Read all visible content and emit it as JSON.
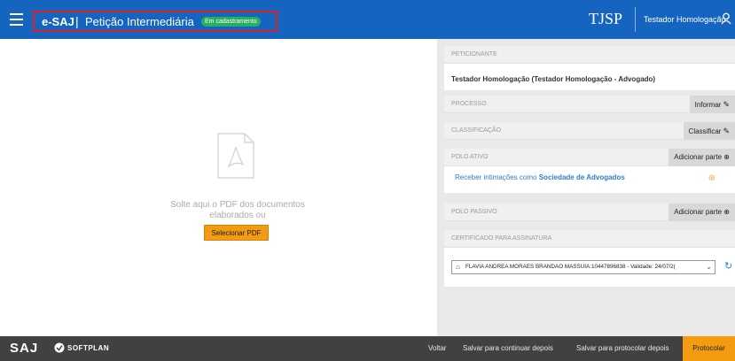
{
  "header": {
    "brand": "e-SAJ",
    "separator": "|",
    "title": "Petição Intermediária",
    "status_badge": "Em cadastramento",
    "court_logo": "TJSP",
    "user_name": "Testador Homologação",
    "menu_icon": "hamburger-icon",
    "user_icon": "user-icon"
  },
  "dropzone": {
    "icon": "pdf-file-icon",
    "text": "Solte aqui o PDF dos documentos elaborados ou",
    "button": "Selecionar PDF"
  },
  "panel": {
    "peticionante": {
      "label": "PETICIONANTE",
      "value": "Testador Homologação (Testador Homologação - Advogado)"
    },
    "processo": {
      "label": "PROCESSO",
      "action": "Informar"
    },
    "classificacao": {
      "label": "CLASSIFICAÇÃO",
      "action": "Classificar"
    },
    "polo_ativo": {
      "label": "POLO ATIVO",
      "action": "Adicionar parte",
      "intimacao_prefix": "Receber intimações como",
      "intimacao_link": "Sociedade de Advogados"
    },
    "polo_passivo": {
      "label": "POLO PASSIVO",
      "action": "Adicionar parte"
    },
    "certificado": {
      "label": "CERTIFICADO PARA ASSINATURA",
      "selected": "FLAVIA ANDREA MORAES BRANDAO MASSUIA:10447896838 - Validade: 24/07/2("
    }
  },
  "footer": {
    "saj_logo": "SAJ",
    "softplan_logo": "SOFTPLAN",
    "voltar": "Voltar",
    "salvar_continuar": "Salvar para continuar depois",
    "salvar_protocolar": "Salvar para protocolar depois",
    "protocolar": "Protocolar"
  },
  "colors": {
    "header_bg": "#1565c0",
    "badge_bg": "#27ae60",
    "accent_orange": "#f39c12",
    "footer_bg": "#414141",
    "link_blue": "#2a7fd6",
    "highlight_border": "#e22020"
  }
}
